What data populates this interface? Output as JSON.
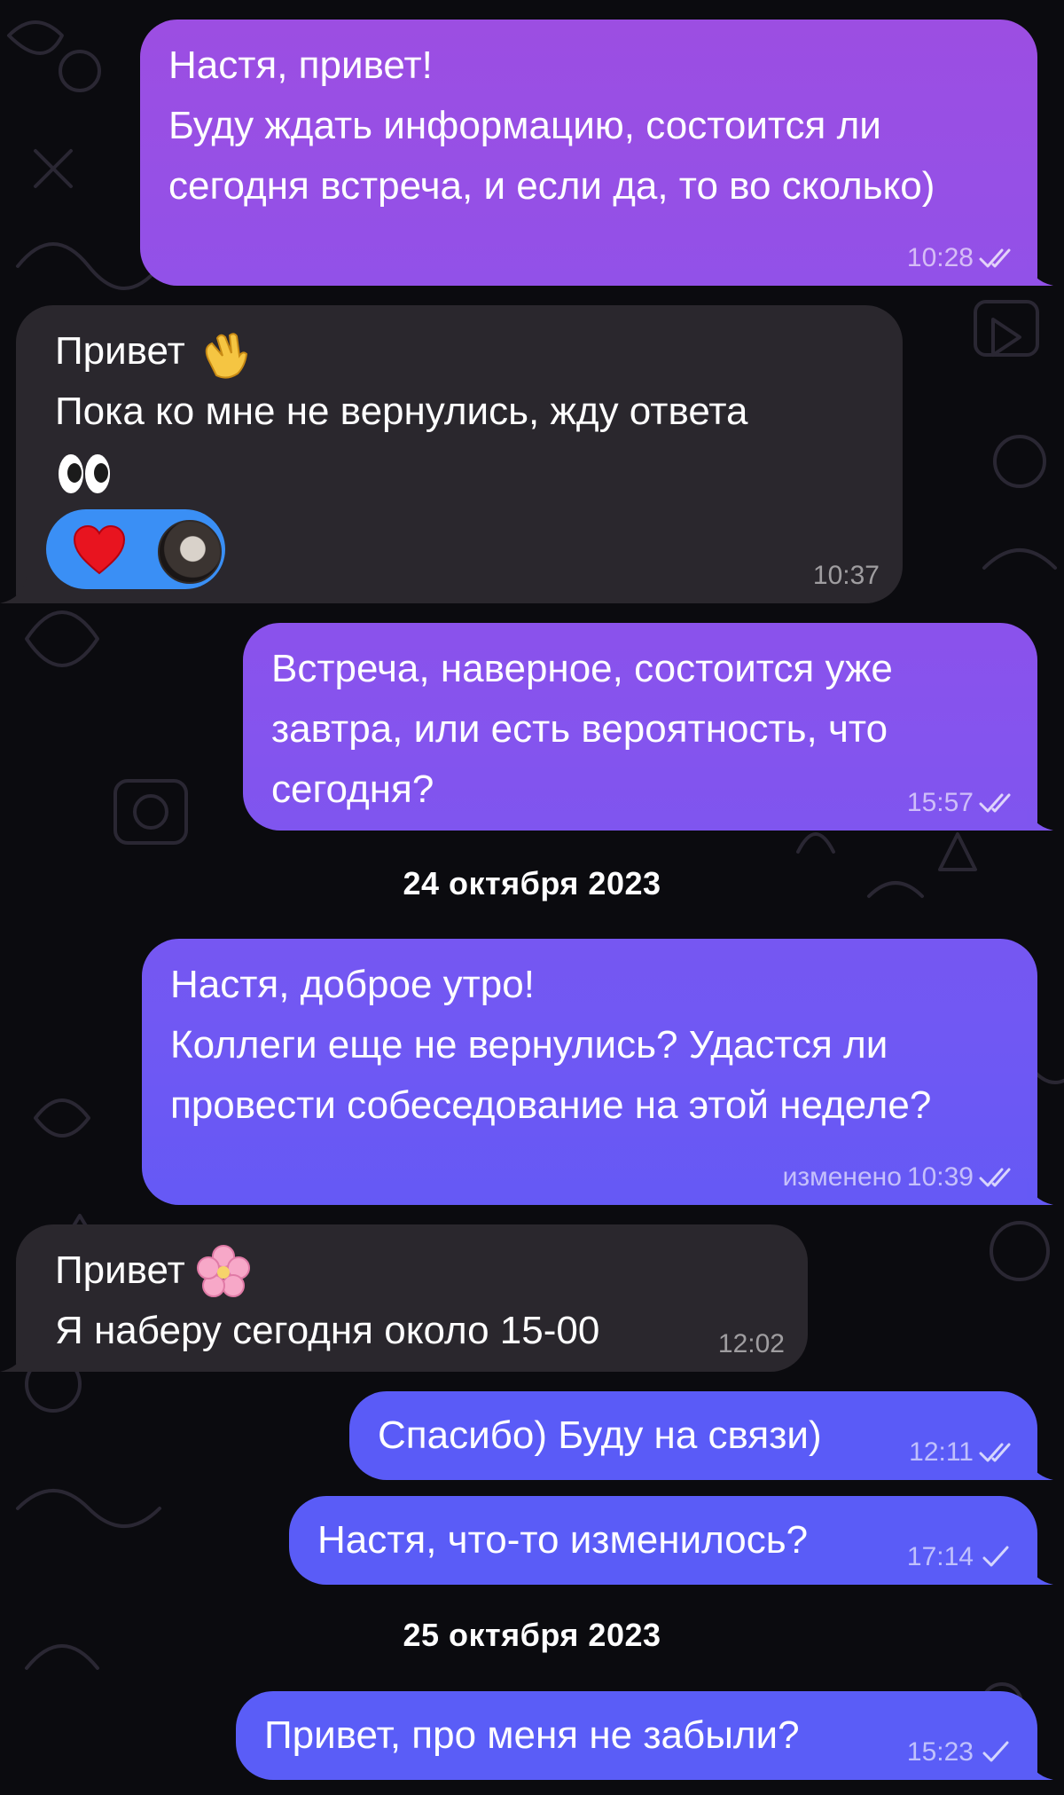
{
  "colors": {
    "background": "#0b0b0f",
    "incoming_bubble": "#2a272d",
    "outgoing_gradient_top": "#9b4fe0",
    "outgoing_gradient_bottom": "#5b57f5",
    "reaction_pill": "#3a8ff5"
  },
  "messages": [
    {
      "direction": "outgoing",
      "text": "Настя, привет!\nБуду ждать информацию, состоится ли сегодня встреча, и если да, то во сколько)",
      "time": "10:28",
      "status": "read"
    },
    {
      "direction": "incoming",
      "line1": "Привет",
      "emoji1": "waving-hand",
      "line2": "Пока ко мне не вернулись, жду ответа",
      "emoji2": "eyes",
      "time": "10:37",
      "reactions": [
        {
          "icon": "red-heart"
        },
        {
          "icon": "user-avatar"
        }
      ]
    },
    {
      "direction": "outgoing",
      "text": "Встреча, наверное, состоится уже завтра, или есть вероятность, что сегодня?",
      "time": "15:57",
      "status": "read"
    },
    {
      "type": "date",
      "text": "24 октября 2023"
    },
    {
      "direction": "outgoing",
      "text": "Настя, доброе утро!\nКоллеги еще не вернулись? Удастся ли провести собеседование на этой неделе?",
      "edited": "изменено",
      "time": "10:39",
      "status": "read"
    },
    {
      "direction": "incoming",
      "line1": "Привет",
      "emoji1": "cherry-blossom",
      "line2": "Я наберу сегодня около 15-00",
      "time": "12:02"
    },
    {
      "direction": "outgoing",
      "text": "Спасибо) Буду на связи)",
      "time": "12:11",
      "status": "read"
    },
    {
      "direction": "outgoing",
      "text": "Настя, что-то изменилось?",
      "time": "17:14",
      "status": "sent"
    },
    {
      "type": "date",
      "text": "25 октября 2023"
    },
    {
      "direction": "outgoing",
      "text": "Привет, про меня не забыли?",
      "time": "15:23",
      "status": "sent"
    }
  ]
}
